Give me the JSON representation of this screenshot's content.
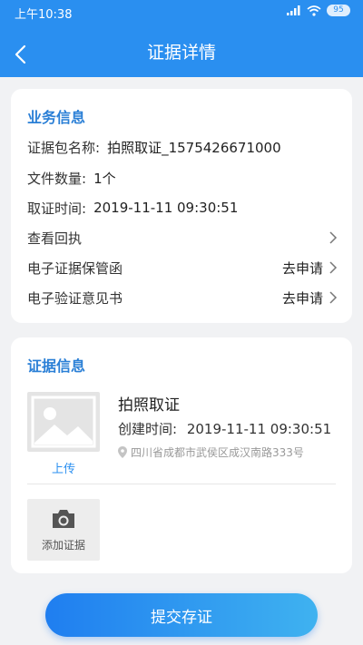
{
  "status_bar": {
    "time": "上午10:38",
    "battery": "95"
  },
  "nav": {
    "title": "证据详情"
  },
  "business_info": {
    "section_title": "业务信息",
    "package_name_label": "证据包名称:",
    "package_name_value": "拍照取证_1575426671000",
    "file_count_label": "文件数量:",
    "file_count_value": "1个",
    "collect_time_label": "取证时间:",
    "collect_time_value": "2019-11-11 09:30:51",
    "receipt_label": "查看回执",
    "custody_letter_label": "电子证据保管函",
    "custody_letter_action": "去申请",
    "opinion_label": "电子验证意见书",
    "opinion_action": "去申请"
  },
  "evidence_info": {
    "section_title": "证据信息",
    "item_title": "拍照取证",
    "created_label": "创建时间:",
    "created_value": "2019-11-11 09:30:51",
    "location": "四川省成都市武侯区成汉南路333号",
    "upload_label": "上传",
    "add_label": "添加证据"
  },
  "submit_label": "提交存证",
  "colors": {
    "header": "#2a8ff0",
    "accent": "#2a7fd6",
    "button_start": "#1f7ef0",
    "button_end": "#3fb2f0"
  }
}
